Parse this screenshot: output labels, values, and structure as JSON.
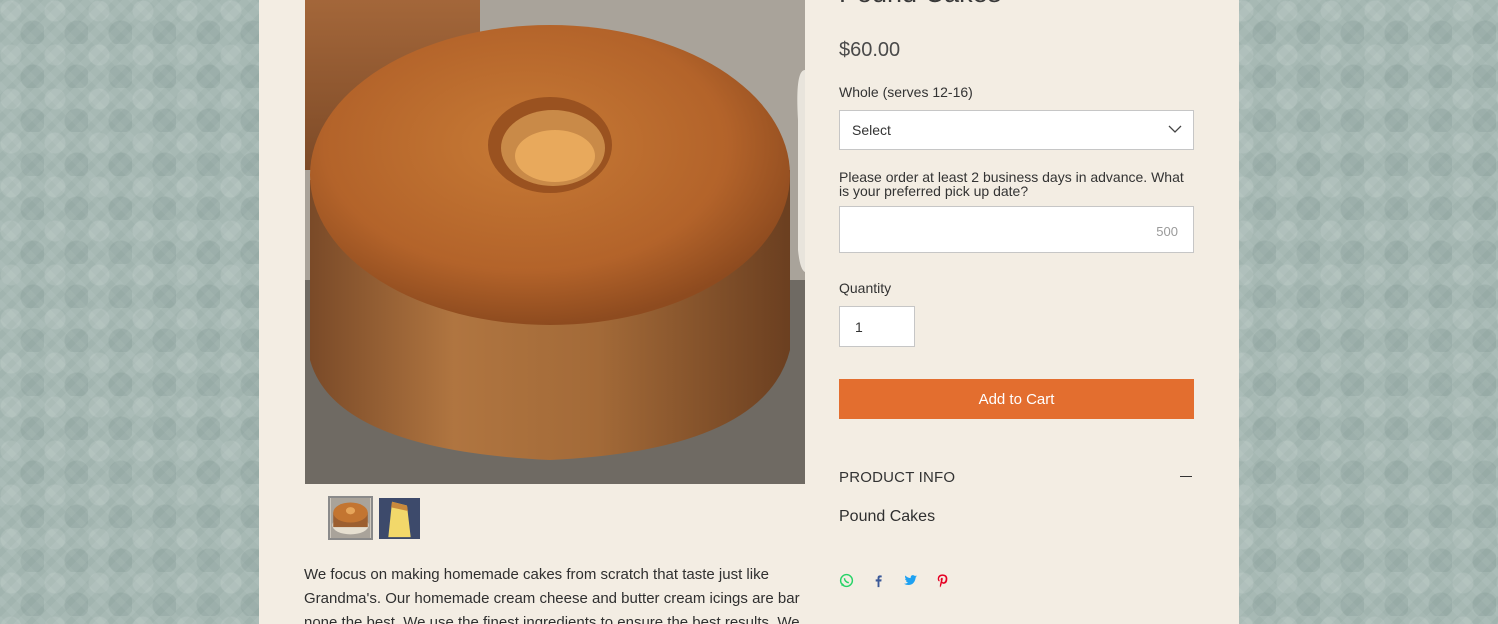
{
  "product": {
    "title": "Pound Cakes",
    "price": "$60.00",
    "option_label": "Whole (serves 12-16)",
    "option_value": "Select",
    "note_label": "Please order at least 2 business days in advance. What is your preferred pick up date?",
    "note_counter": "500",
    "quantity_label": "Quantity",
    "quantity_value": "1",
    "add_to_cart": "Add to Cart",
    "info_heading": "PRODUCT INFO",
    "info_text": "Pound Cakes",
    "description": "We focus on making homemade cakes from scratch that taste just like Grandma's. Our homemade cream cheese and butter cream icings are bar none the best. We use the finest ingredients to ensure the best results. We"
  },
  "gallery": {
    "thumbnails": [
      "pound-cake-whole",
      "pound-cake-slice"
    ],
    "active_index": 0
  },
  "share_icons": [
    "whatsapp-icon",
    "facebook-icon",
    "twitter-icon",
    "pinterest-icon"
  ],
  "colors": {
    "accent": "#e36e2f",
    "page_background": "#f3ede3",
    "outer_background": "#a7b9b4",
    "whatsapp": "#25d366",
    "facebook": "#3b5998",
    "twitter": "#1da1f2",
    "pinterest": "#e60023"
  }
}
